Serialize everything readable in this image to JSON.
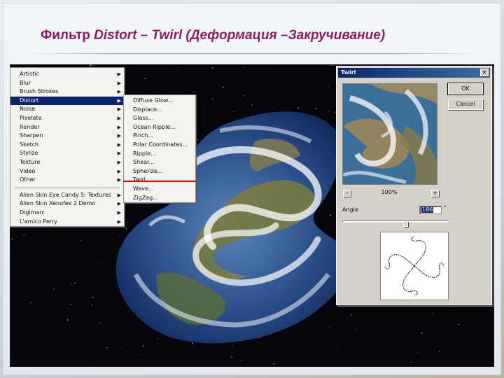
{
  "title": {
    "prefix": "Фильтр ",
    "filter_path": "Distort – Twirl",
    "suffix": " (Деформация –Закручивание)"
  },
  "filter_menu": {
    "items": [
      {
        "label": "Artistic",
        "has_submenu": true
      },
      {
        "label": "Blur",
        "has_submenu": true
      },
      {
        "label": "Brush Strokes",
        "has_submenu": true
      },
      {
        "label": "Distort",
        "has_submenu": true,
        "selected": true
      },
      {
        "label": "Noise",
        "has_submenu": true
      },
      {
        "label": "Pixelate",
        "has_submenu": true
      },
      {
        "label": "Render",
        "has_submenu": true
      },
      {
        "label": "Sharpen",
        "has_submenu": true
      },
      {
        "label": "Sketch",
        "has_submenu": true
      },
      {
        "label": "Stylize",
        "has_submenu": true
      },
      {
        "label": "Texture",
        "has_submenu": true
      },
      {
        "label": "Video",
        "has_submenu": true
      },
      {
        "label": "Other",
        "has_submenu": true
      }
    ],
    "plugins": [
      {
        "label": "Alien Skin Eye Candy 5: Textures",
        "has_submenu": true
      },
      {
        "label": "Alien Skin Xenofex 2 Demo",
        "has_submenu": true
      },
      {
        "label": "Digimarc",
        "has_submenu": true
      },
      {
        "label": "L'amico Perry",
        "has_submenu": true
      }
    ],
    "arrow_glyph": "▶"
  },
  "distort_submenu": {
    "items": [
      {
        "label": "Diffuse Glow..."
      },
      {
        "label": "Displace..."
      },
      {
        "label": "Glass..."
      },
      {
        "label": "Ocean Ripple..."
      },
      {
        "label": "Pinch..."
      },
      {
        "label": "Polar Coordinates..."
      },
      {
        "label": "Ripple..."
      },
      {
        "label": "Shear..."
      },
      {
        "label": "Spherize..."
      },
      {
        "label": "Twirl...",
        "highlighted": true
      },
      {
        "label": "Wave..."
      },
      {
        "label": "ZigZag..."
      }
    ],
    "highlight_color": "#d40000"
  },
  "twirl_dialog": {
    "title": "Twirl",
    "close_glyph": "✕",
    "ok_label": "OK",
    "cancel_label": "Cancel",
    "zoom_minus": "-",
    "zoom_plus": "+",
    "zoom_level": "100%",
    "angle_label": "Angle",
    "angle_value": "186",
    "angle_unit": "°",
    "angle_slider_fraction": 0.592
  },
  "colors": {
    "title": "#8b1d68",
    "menu_selection": "#0a246a",
    "dialog_face": "#d4d0c8"
  }
}
